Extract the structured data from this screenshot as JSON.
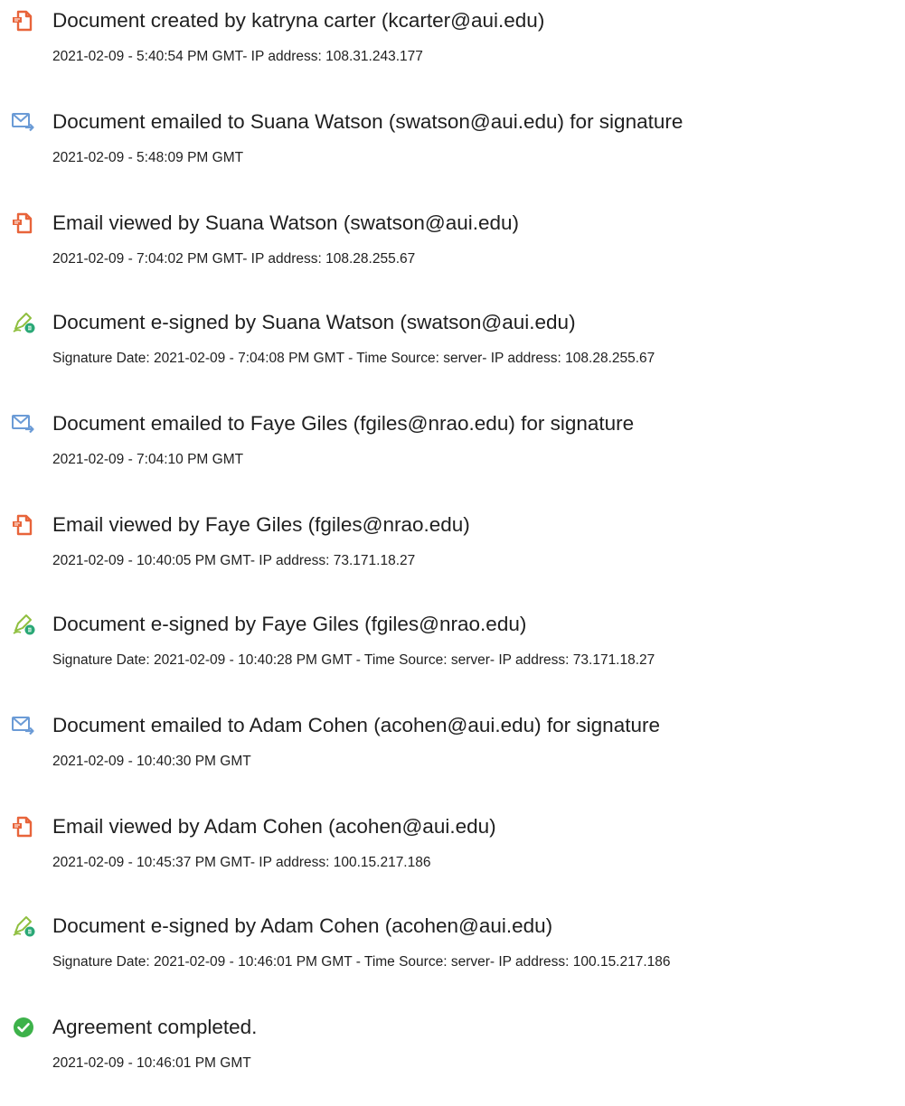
{
  "events": [
    {
      "icon": "document-created-icon",
      "title": "Document created by katryna carter (kcarter@aui.edu)",
      "detail": "2021-02-09 - 5:40:54 PM GMT- IP address: 108.31.243.177"
    },
    {
      "icon": "email-sent-icon",
      "title": "Document emailed to Suana Watson (swatson@aui.edu) for signature",
      "detail": "2021-02-09 - 5:48:09 PM GMT"
    },
    {
      "icon": "document-viewed-icon",
      "title": "Email viewed by Suana Watson (swatson@aui.edu)",
      "detail": "2021-02-09 - 7:04:02 PM GMT- IP address: 108.28.255.67"
    },
    {
      "icon": "pen-signed-icon",
      "title": "Document e-signed by Suana Watson (swatson@aui.edu)",
      "detail": "Signature Date: 2021-02-09 - 7:04:08 PM GMT - Time Source: server- IP address: 108.28.255.67"
    },
    {
      "icon": "email-sent-icon",
      "title": "Document emailed to Faye Giles (fgiles@nrao.edu) for signature",
      "detail": "2021-02-09 - 7:04:10 PM GMT"
    },
    {
      "icon": "document-viewed-icon",
      "title": "Email viewed by Faye Giles (fgiles@nrao.edu)",
      "detail": "2021-02-09 - 10:40:05 PM GMT- IP address: 73.171.18.27"
    },
    {
      "icon": "pen-signed-icon",
      "title": "Document e-signed by Faye Giles (fgiles@nrao.edu)",
      "detail": "Signature Date: 2021-02-09 - 10:40:28 PM GMT - Time Source: server- IP address: 73.171.18.27"
    },
    {
      "icon": "email-sent-icon",
      "title": "Document emailed to Adam Cohen (acohen@aui.edu) for signature",
      "detail": "2021-02-09 - 10:40:30 PM GMT"
    },
    {
      "icon": "document-viewed-icon",
      "title": "Email viewed by Adam Cohen (acohen@aui.edu)",
      "detail": "2021-02-09 - 10:45:37 PM GMT- IP address: 100.15.217.186"
    },
    {
      "icon": "pen-signed-icon",
      "title": "Document e-signed by Adam Cohen (acohen@aui.edu)",
      "detail": "Signature Date: 2021-02-09 - 10:46:01 PM GMT - Time Source: server- IP address: 100.15.217.186"
    },
    {
      "icon": "checkmark-complete-icon",
      "title": "Agreement completed.",
      "detail": "2021-02-09 - 10:46:01 PM GMT"
    }
  ],
  "colors": {
    "document_icon": "#e8643a",
    "email_icon": "#6b9bd6",
    "pen_icon": "#8fbf3f",
    "pen_badge": "#2aa876",
    "check_icon": "#3db24a",
    "text": "#1f1f1f"
  }
}
